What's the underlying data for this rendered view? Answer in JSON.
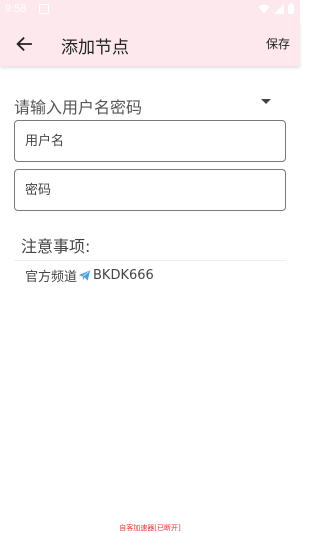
{
  "status_bar": {
    "time": "9:58",
    "icons": [
      "notification-icon",
      "wifi-icon",
      "signal-icon",
      "battery-icon"
    ]
  },
  "app_bar": {
    "back_icon": "arrow-left-icon",
    "title": "添加节点",
    "save_label": "保存"
  },
  "form": {
    "section_label": "请输入用户名密码",
    "dropdown_icon": "dropdown-arrow-icon",
    "username": {
      "value": "",
      "placeholder": "用户名"
    },
    "password": {
      "value": "",
      "placeholder": "密码"
    }
  },
  "notes": {
    "title": "注意事项:",
    "channel_prefix": "官方频道",
    "channel_icon": "paper-plane-icon",
    "channel_id": "BKDK666"
  },
  "footer": {
    "status_text": "自客加速器[已断开]"
  },
  "colors": {
    "app_bar_bg": "#fde8ee",
    "footer_text": "#e53935",
    "plane_icon": "#4aa3df"
  }
}
